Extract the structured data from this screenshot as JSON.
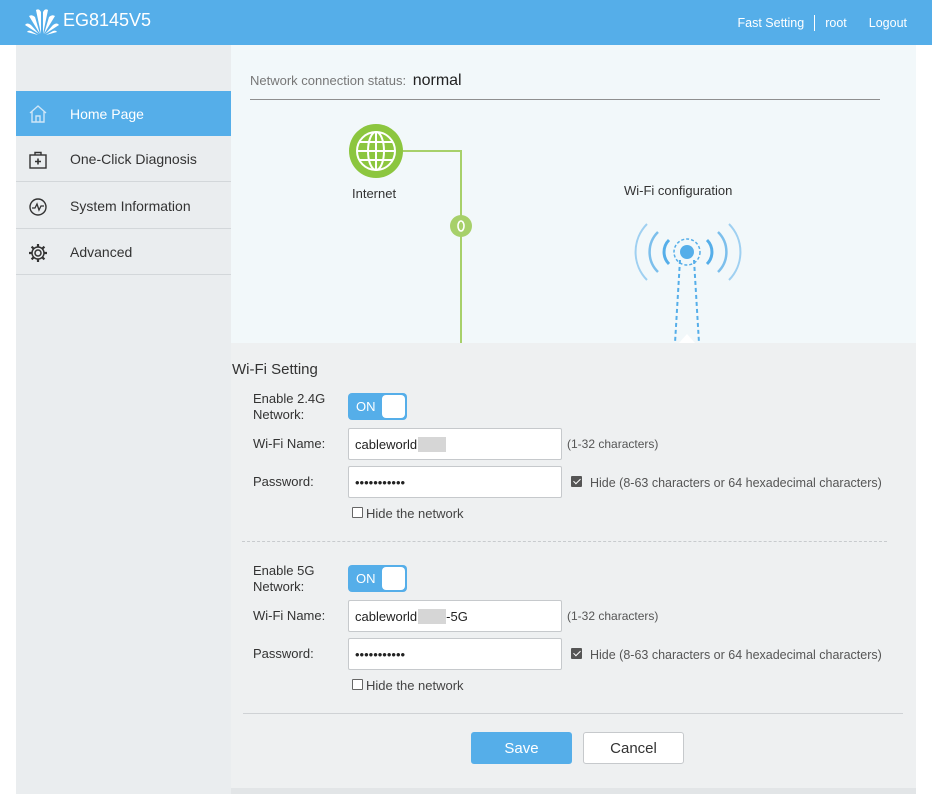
{
  "header": {
    "model": "EG8145V5",
    "links": [
      "Fast Setting",
      "root",
      "Logout"
    ]
  },
  "sidebar": {
    "items": [
      {
        "label": "Home Page",
        "icon": "home-icon",
        "active": true
      },
      {
        "label": "One-Click Diagnosis",
        "icon": "medical-kit-icon",
        "active": false
      },
      {
        "label": "System Information",
        "icon": "pulse-icon",
        "active": false
      },
      {
        "label": "Advanced",
        "icon": "gear-icon",
        "active": false
      }
    ]
  },
  "status": {
    "label": "Network connection status:",
    "value": "normal"
  },
  "diagram": {
    "internet_label": "Internet",
    "wifi_label": "Wi-Fi configuration"
  },
  "wifi": {
    "title": "Wi-Fi Setting",
    "band24": {
      "enable_label": "Enable 2.4G Network:",
      "toggle": "ON",
      "name_label": "Wi-Fi Name:",
      "name_value_prefix": "cableworld",
      "name_value_suffix": "",
      "name_hint": "(1-32 characters)",
      "password_label": "Password:",
      "password_value": "•••••••••••",
      "hide_pw_label": "Hide (8-63 characters or 64 hexadecimal characters)",
      "hide_pw_checked": true,
      "hide_network_label": "Hide the network",
      "hide_network_checked": false
    },
    "band5": {
      "enable_label": "Enable 5G Network:",
      "toggle": "ON",
      "name_label": "Wi-Fi Name:",
      "name_value_prefix": "cableworld",
      "name_value_suffix": "-5G",
      "name_hint": "(1-32 characters)",
      "password_label": "Password:",
      "password_value": "•••••••••••",
      "hide_pw_label": "Hide (8-63 characters or 64 hexadecimal characters)",
      "hide_pw_checked": true,
      "hide_network_label": "Hide the network",
      "hide_network_checked": false
    },
    "save_label": "Save",
    "cancel_label": "Cancel"
  },
  "colors": {
    "accent": "#55aee9",
    "internet_green": "#8cc63f",
    "sidebar_bg": "#eaedef"
  }
}
